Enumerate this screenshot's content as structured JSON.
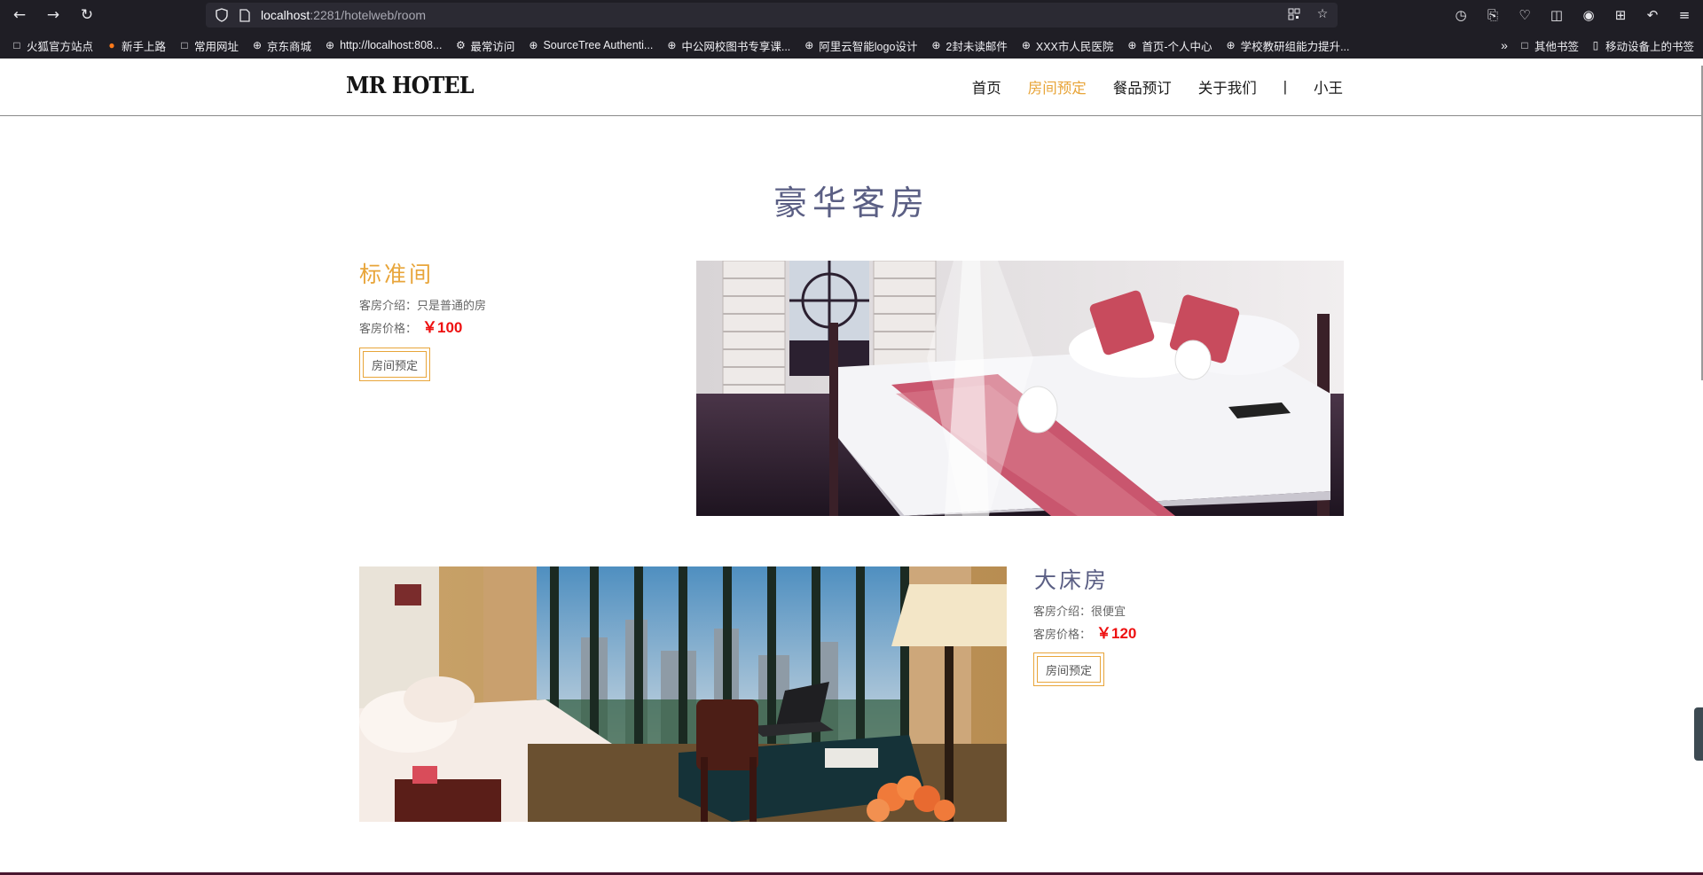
{
  "browser": {
    "url_host": "localhost",
    "url_rest": ":2281/hotelweb/room",
    "bookmarks": [
      {
        "label": "火狐官方站点",
        "icon": "folder-icon"
      },
      {
        "label": "新手上路",
        "icon": "firefox-icon"
      },
      {
        "label": "常用网址",
        "icon": "folder-icon"
      },
      {
        "label": "京东商城",
        "icon": "globe-icon"
      },
      {
        "label": "http://localhost:808...",
        "icon": "globe-icon"
      },
      {
        "label": "最常访问",
        "icon": "gear-icon"
      },
      {
        "label": "SourceTree Authenti...",
        "icon": "globe-icon"
      },
      {
        "label": "中公网校图书专享课...",
        "icon": "globe-icon"
      },
      {
        "label": "阿里云智能logo设计",
        "icon": "globe-icon"
      },
      {
        "label": "2封未读邮件",
        "icon": "globe-icon"
      },
      {
        "label": "XXX市人民医院",
        "icon": "globe-icon"
      },
      {
        "label": "首页-个人中心",
        "icon": "globe-icon"
      },
      {
        "label": "学校教研组能力提升...",
        "icon": "globe-icon"
      }
    ],
    "other_bookmarks": "其他书签",
    "mobile_bookmarks": "移动设备上的书签"
  },
  "site": {
    "logo": "MR HOTEL",
    "nav": {
      "home": "首页",
      "rooms": "房间预定",
      "food": "餐品预订",
      "about": "关于我们",
      "separator": "|",
      "user": "小王"
    },
    "accent_color": "#e8a53a",
    "price_color": "#ee1111",
    "title_color": "#5b5f84"
  },
  "section_title": "豪华客房",
  "rooms": [
    {
      "name": "标准间",
      "intro_label": "客房介绍：",
      "intro": "只是普通的房",
      "price_label": "客房价格：",
      "price": "￥100",
      "button": "房间预定",
      "name_color": "#e8a53a"
    },
    {
      "name": "大床房",
      "intro_label": "客房介绍：",
      "intro": "很便宜",
      "price_label": "客房价格：",
      "price": "￥120",
      "button": "房间预定",
      "name_color": "#5b5f84"
    }
  ]
}
